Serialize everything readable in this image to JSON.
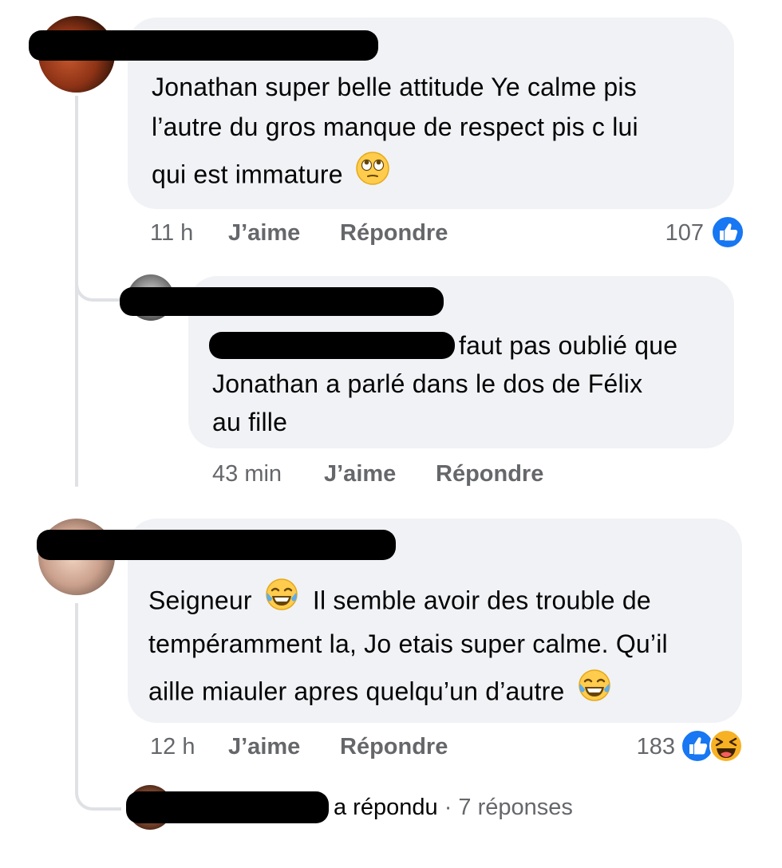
{
  "comments": [
    {
      "text_lines": [
        "Jonathan super belle attitude Ye calme pis",
        "l’autre du gros manque de respect pis c lui",
        "qui est immature"
      ],
      "trailing_emoji": "face-with-rolling-eyes",
      "time": "11 h",
      "like_label": "J’aime",
      "reply_label": "Répondre",
      "reaction_count": "107",
      "reactions": [
        "like"
      ]
    },
    {
      "text_lines": [
        "faut pas oublié que",
        "Jonathan a parlé dans le dos de Félix",
        "au fille"
      ],
      "time": "43 min",
      "like_label": "J’aime",
      "reply_label": "Répondre"
    },
    {
      "text_lines": [
        "Seigneur",
        "Il semble avoir des trouble de",
        "tempéramment la, Jo etais super calme. Qu’il",
        "aille miauler apres quelqu’un d’autre"
      ],
      "inline_emoji": "face-with-tears-of-joy",
      "trailing_emoji": "face-with-tears-of-joy",
      "time": "12 h",
      "like_label": "J’aime",
      "reply_label": "Répondre",
      "reaction_count": "183",
      "reactions": [
        "like",
        "haha"
      ]
    }
  ],
  "reply_summary": {
    "replied_text": "a répondu",
    "separator": "·",
    "count_text": "7 réponses"
  },
  "colors": {
    "bubble": "#f0f2f5",
    "muted_text": "#65676b",
    "like_blue": "#1877f2",
    "haha_yellow": "#f7b125"
  }
}
